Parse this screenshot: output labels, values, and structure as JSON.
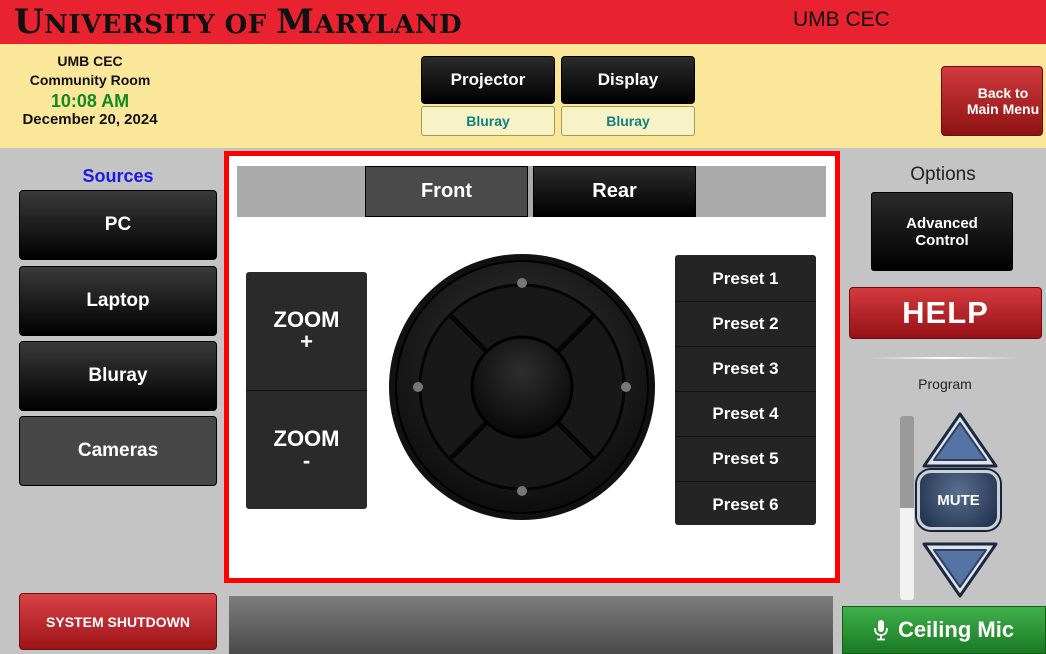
{
  "header": {
    "brand_part1_big": "U",
    "brand_part1_small": "NIVERSITY OF ",
    "brand_part2_big": "M",
    "brand_part2_small": "ARYLAND",
    "site": "UMB CEC",
    "accent_color": "#e8232f"
  },
  "room": {
    "line1": "UMB CEC",
    "line2": "Community Room",
    "time": "10:08 AM",
    "date": "December 20, 2024"
  },
  "devices": [
    {
      "label": "Projector",
      "source": "Bluray"
    },
    {
      "label": "Display",
      "source": "Bluray"
    }
  ],
  "back_button": "Back to\nMain Menu",
  "sources": {
    "title": "Sources",
    "items": [
      {
        "label": "PC",
        "active": false
      },
      {
        "label": "Laptop",
        "active": false
      },
      {
        "label": "Bluray",
        "active": false
      },
      {
        "label": "Cameras",
        "active": true
      }
    ]
  },
  "system_shutdown": "SYSTEM SHUTDOWN",
  "camera": {
    "tabs": [
      {
        "label": "Front",
        "active": true
      },
      {
        "label": "Rear",
        "active": false
      }
    ],
    "zoom_in": "ZOOM\n+",
    "zoom_out": "ZOOM\n-",
    "dpad_icon": "directional-pad-icon",
    "presets": [
      "Preset 1",
      "Preset 2",
      "Preset 3",
      "Preset 4",
      "Preset 5",
      "Preset 6"
    ]
  },
  "options": {
    "title": "Options",
    "advanced": "Advanced\nControl",
    "help": "HELP",
    "program_label": "Program",
    "volume_level": 0.5,
    "volume_up_icon": "triangle-up-icon",
    "volume_down_icon": "triangle-down-icon",
    "mute": "MUTE",
    "mic_label": "Ceiling Mic",
    "mic_icon": "microphone-icon"
  }
}
